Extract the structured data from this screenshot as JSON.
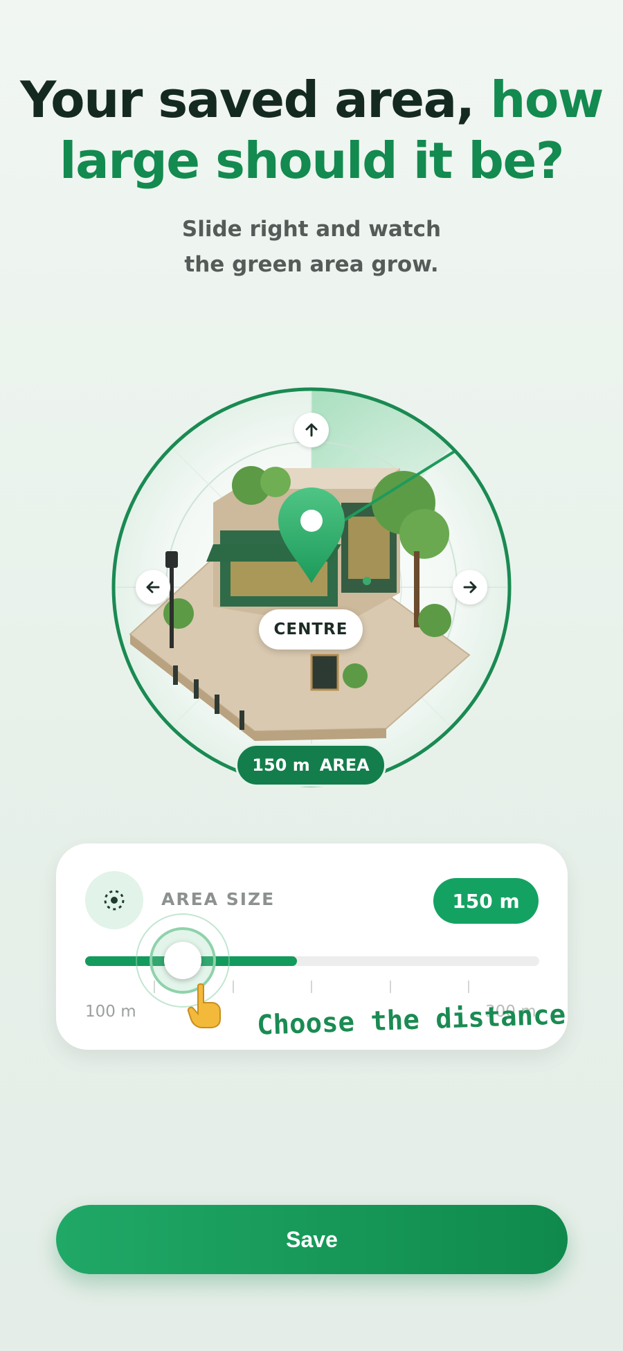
{
  "header": {
    "title_part1": "Your saved area,",
    "title_part2": "how",
    "title_part3": "large should it be?",
    "subtitle_line1": "Slide right and watch",
    "subtitle_line2": "the green area grow."
  },
  "map": {
    "centre_label": "CENTRE",
    "area_value": "150 m",
    "area_label": "AREA"
  },
  "area_card": {
    "title": "AREA SIZE",
    "value": "150 m",
    "min_label": "100 m",
    "max_label": "300 m",
    "slider_value_m": 150,
    "slider_min_m": 100,
    "slider_max_m": 300,
    "hint": "Choose the distance"
  },
  "actions": {
    "save_label": "Save"
  },
  "colors": {
    "brand_green": "#138a4f",
    "accent_green": "#14a263",
    "title_dark": "#142a20"
  },
  "icons": {
    "area_icon": "target-dots-icon",
    "up": "arrow-up-icon",
    "left": "arrow-left-icon",
    "right": "arrow-right-icon",
    "pin": "map-pin-icon",
    "hand": "pointing-hand-icon"
  }
}
